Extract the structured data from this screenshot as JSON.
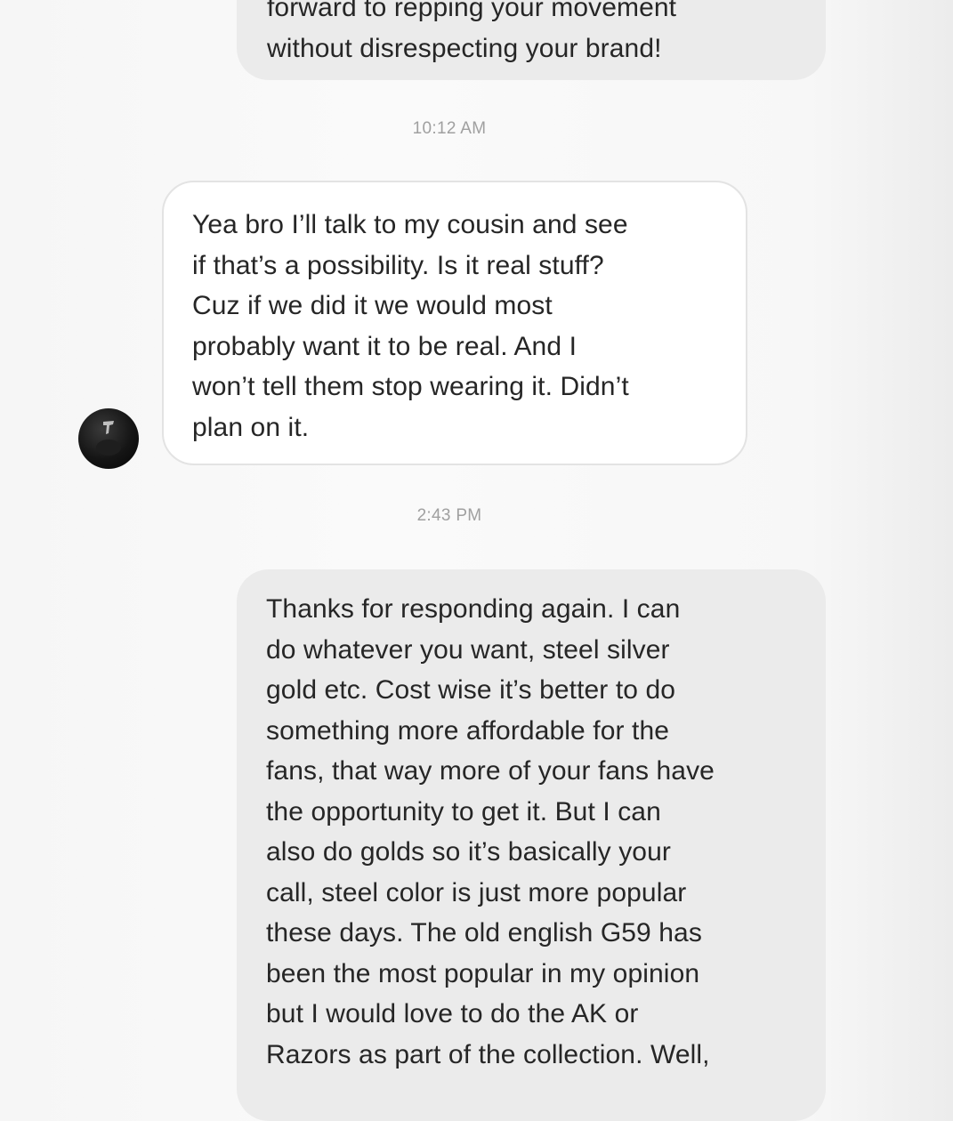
{
  "conversation": {
    "messages": [
      {
        "direction": "sent",
        "text": "forward to repping your movement\nwithout disrespecting your brand!"
      },
      {
        "direction": "received",
        "text": "Yea bro I’ll talk to my cousin and see\nif that’s a possibility. Is it real stuff?\nCuz if we did it we would most\nprobably want it to be real. And I\nwon’t tell them stop wearing it. Didn’t\nplan on it."
      },
      {
        "direction": "sent",
        "text": "Thanks for responding again. I can\ndo whatever you want, steel silver\ngold etc. Cost wise it’s better to do\nsomething more affordable for the\nfans, that way more of your fans have\nthe opportunity to get it. But I can\nalso do golds so it’s basically your\ncall, steel color is just more popular\nthese days. The old english G59 has\nbeen the most popular in my opinion\nbut I would love to do the AK or\nRazors as part of the collection. Well,"
      }
    ],
    "timestamps": [
      "10:12 AM",
      "2:43 PM"
    ]
  },
  "icons": {
    "avatar": "contact-avatar-photo"
  },
  "colors": {
    "sent_bubble": "#ebebeb",
    "received_bubble": "#ffffff",
    "received_border": "#e3e3e3",
    "text": "#262626",
    "timestamp": "#a0a0a0"
  }
}
